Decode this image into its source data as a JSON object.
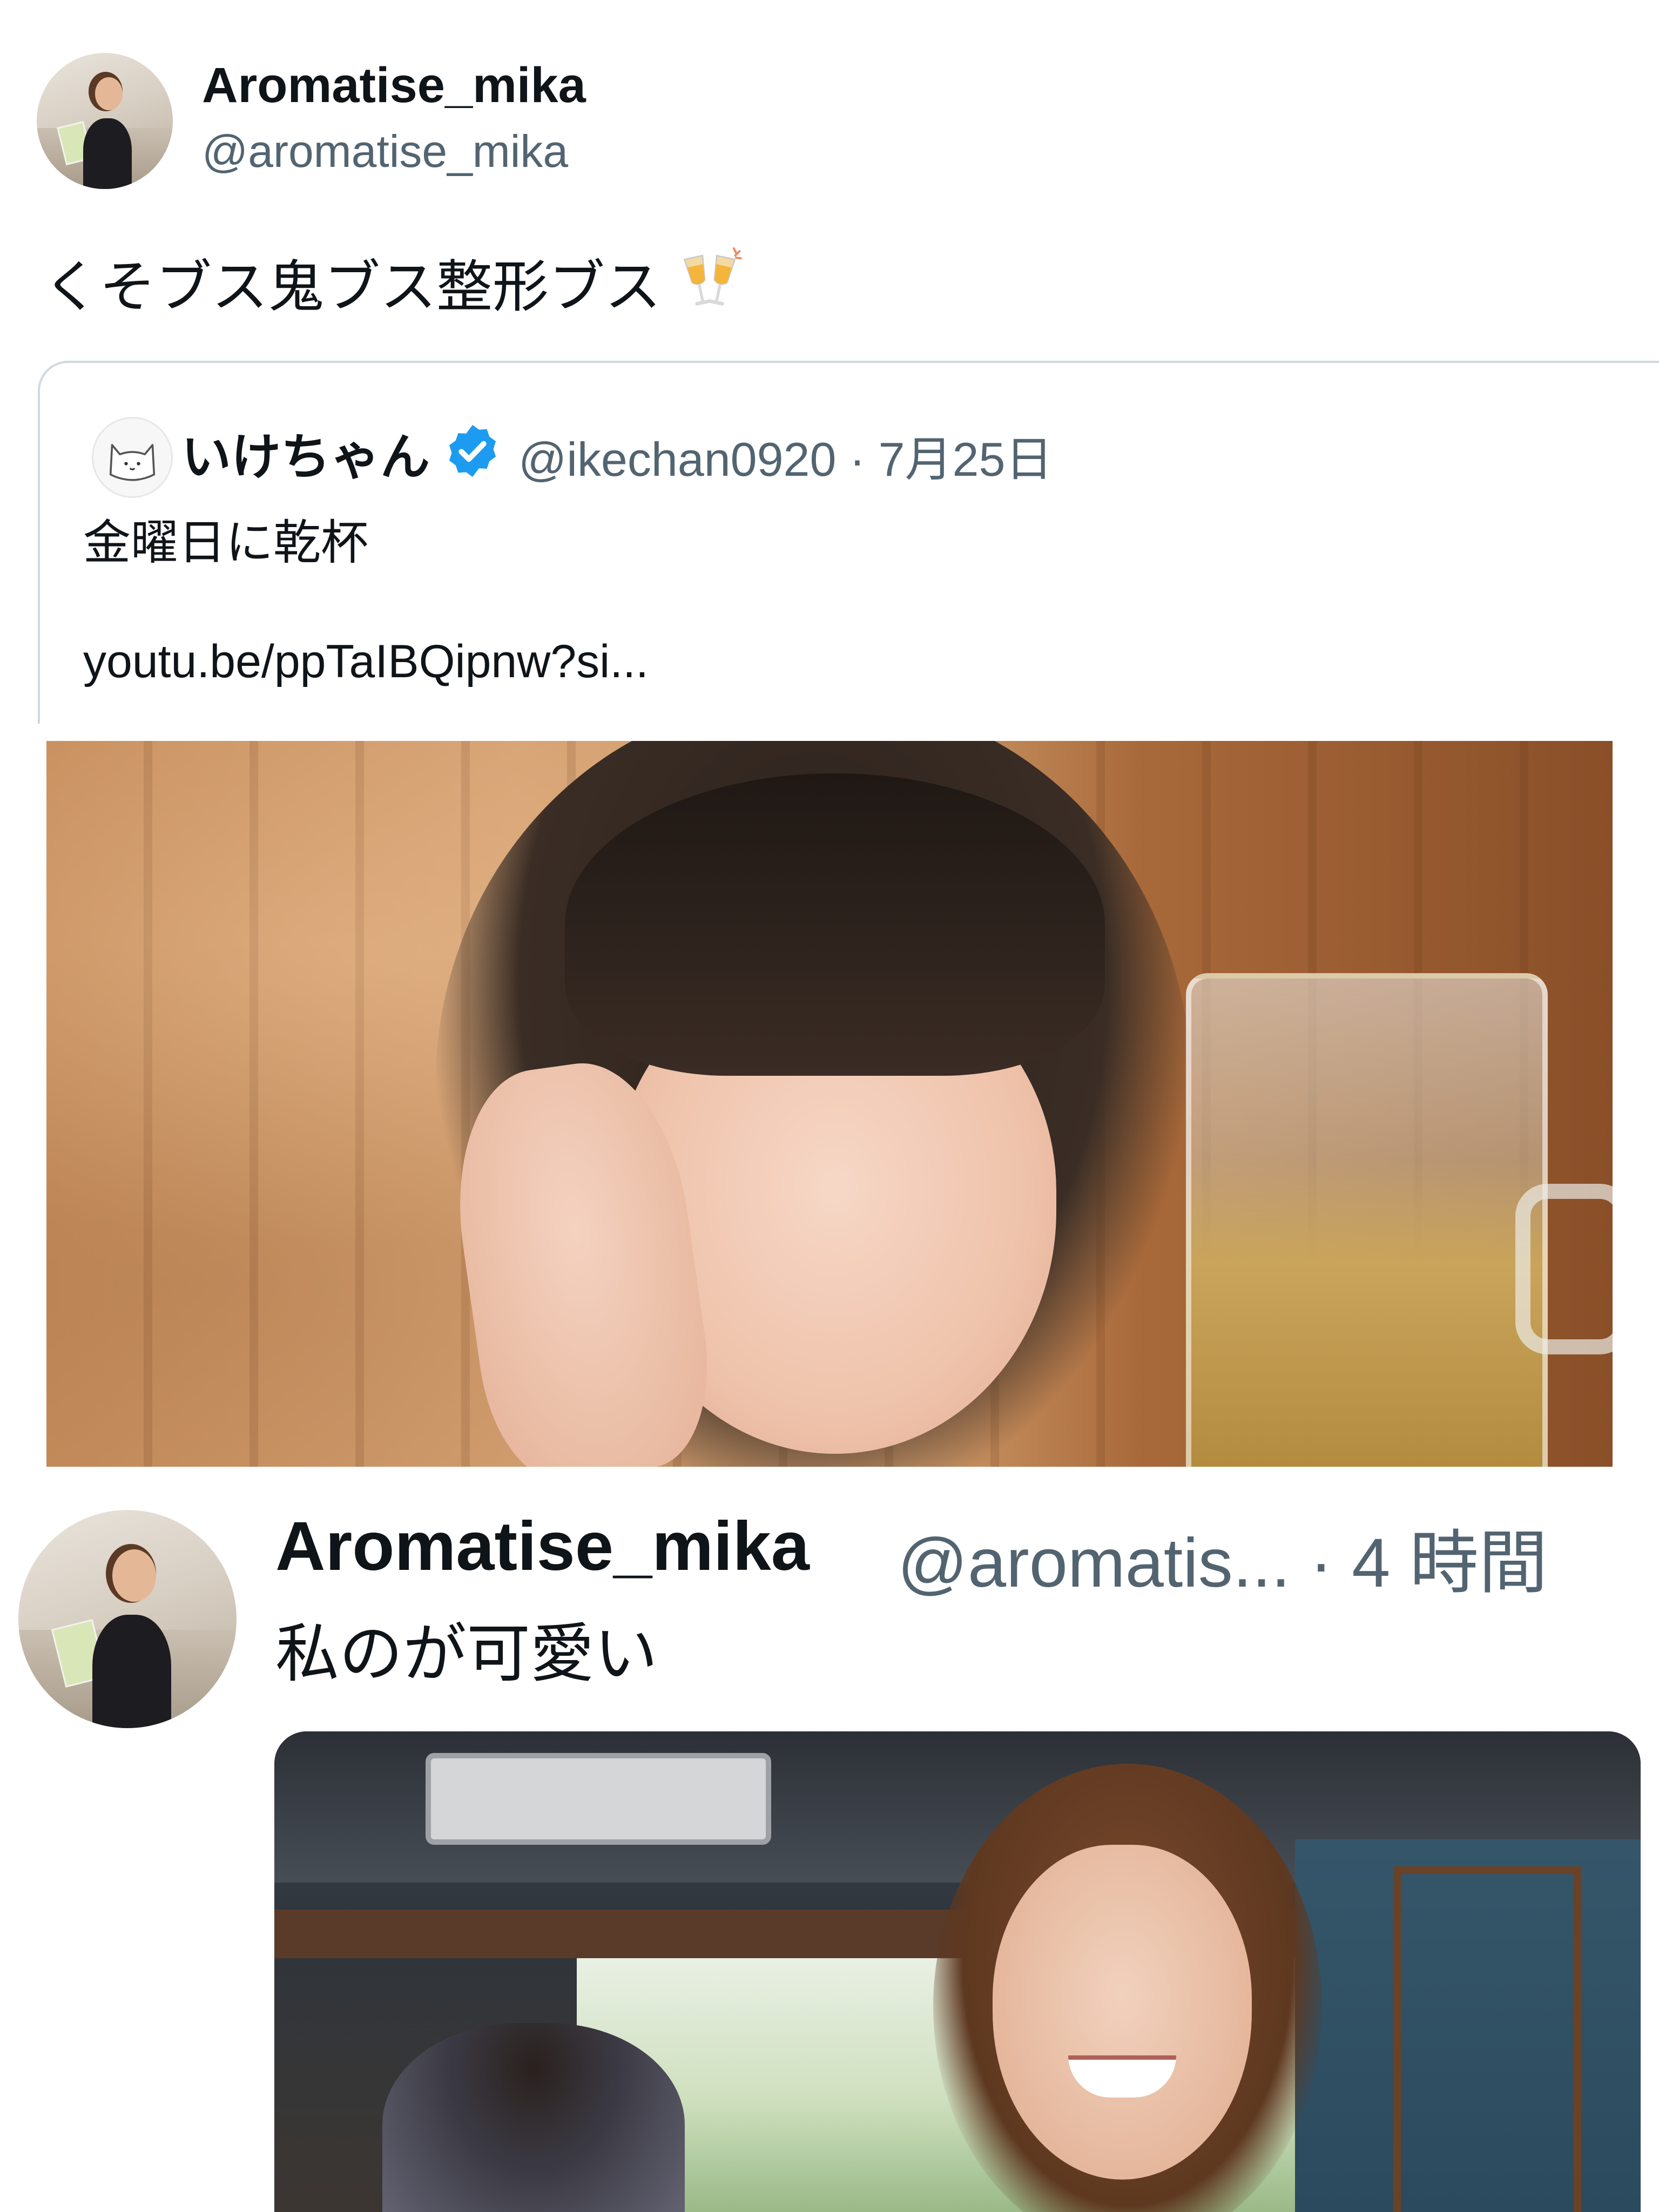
{
  "post1": {
    "display_name": "Aromatise_mika",
    "handle": "@aromatise_mika",
    "text": "くそブス鬼ブス整形ブス",
    "emoji": "clinking-glasses-icon"
  },
  "quote": {
    "display_name": "いけちゃん",
    "verified": true,
    "meta": "@ikechan0920 · 7月25日",
    "text": "金曜日に乾杯",
    "link": "youtu.be/ppTaIBQipnw?si..."
  },
  "post2": {
    "display_name": "Aromatise_mika",
    "handle_time": "@aromatis... · 4 時間",
    "text": "私のが可愛い"
  },
  "colors": {
    "text_primary": "#0f1419",
    "text_secondary": "#536471",
    "border": "#cfd9de",
    "verified_blue": "#1d9bf0"
  }
}
